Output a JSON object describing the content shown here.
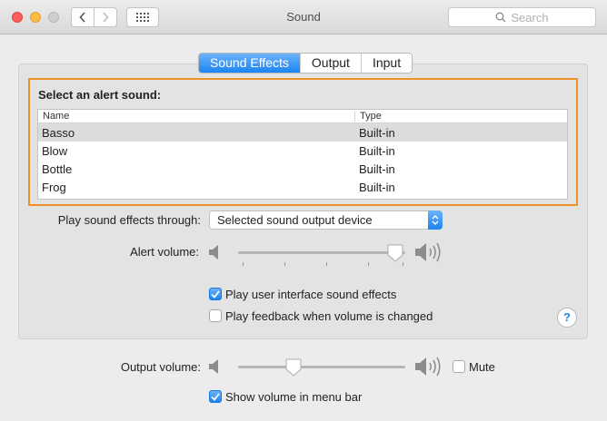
{
  "window": {
    "title": "Sound"
  },
  "search": {
    "placeholder": "Search"
  },
  "tabs": [
    {
      "label": "Sound Effects",
      "active": true
    },
    {
      "label": "Output",
      "active": false
    },
    {
      "label": "Input",
      "active": false
    }
  ],
  "alert": {
    "heading": "Select an alert sound:",
    "columns": {
      "name": "Name",
      "type": "Type"
    },
    "rows": [
      {
        "name": "Basso",
        "type": "Built-in",
        "selected": true
      },
      {
        "name": "Blow",
        "type": "Built-in",
        "selected": false
      },
      {
        "name": "Bottle",
        "type": "Built-in",
        "selected": false
      },
      {
        "name": "Frog",
        "type": "Built-in",
        "selected": false
      }
    ]
  },
  "effects_through": {
    "label": "Play sound effects through:",
    "value": "Selected sound output device"
  },
  "alert_volume": {
    "label": "Alert volume:",
    "level": 0.94
  },
  "checkboxes": {
    "ui_sounds": {
      "label": "Play user interface sound effects",
      "checked": true
    },
    "feedback": {
      "label": "Play feedback when volume is changed",
      "checked": false
    },
    "show_in_menu": {
      "label": "Show volume in menu bar",
      "checked": true
    }
  },
  "output_volume": {
    "label": "Output volume:",
    "level": 0.33,
    "mute_label": "Mute",
    "muted": false
  },
  "help_label": "?",
  "colors": {
    "accent": "#1b84f2",
    "highlight_border": "#f0922a"
  }
}
